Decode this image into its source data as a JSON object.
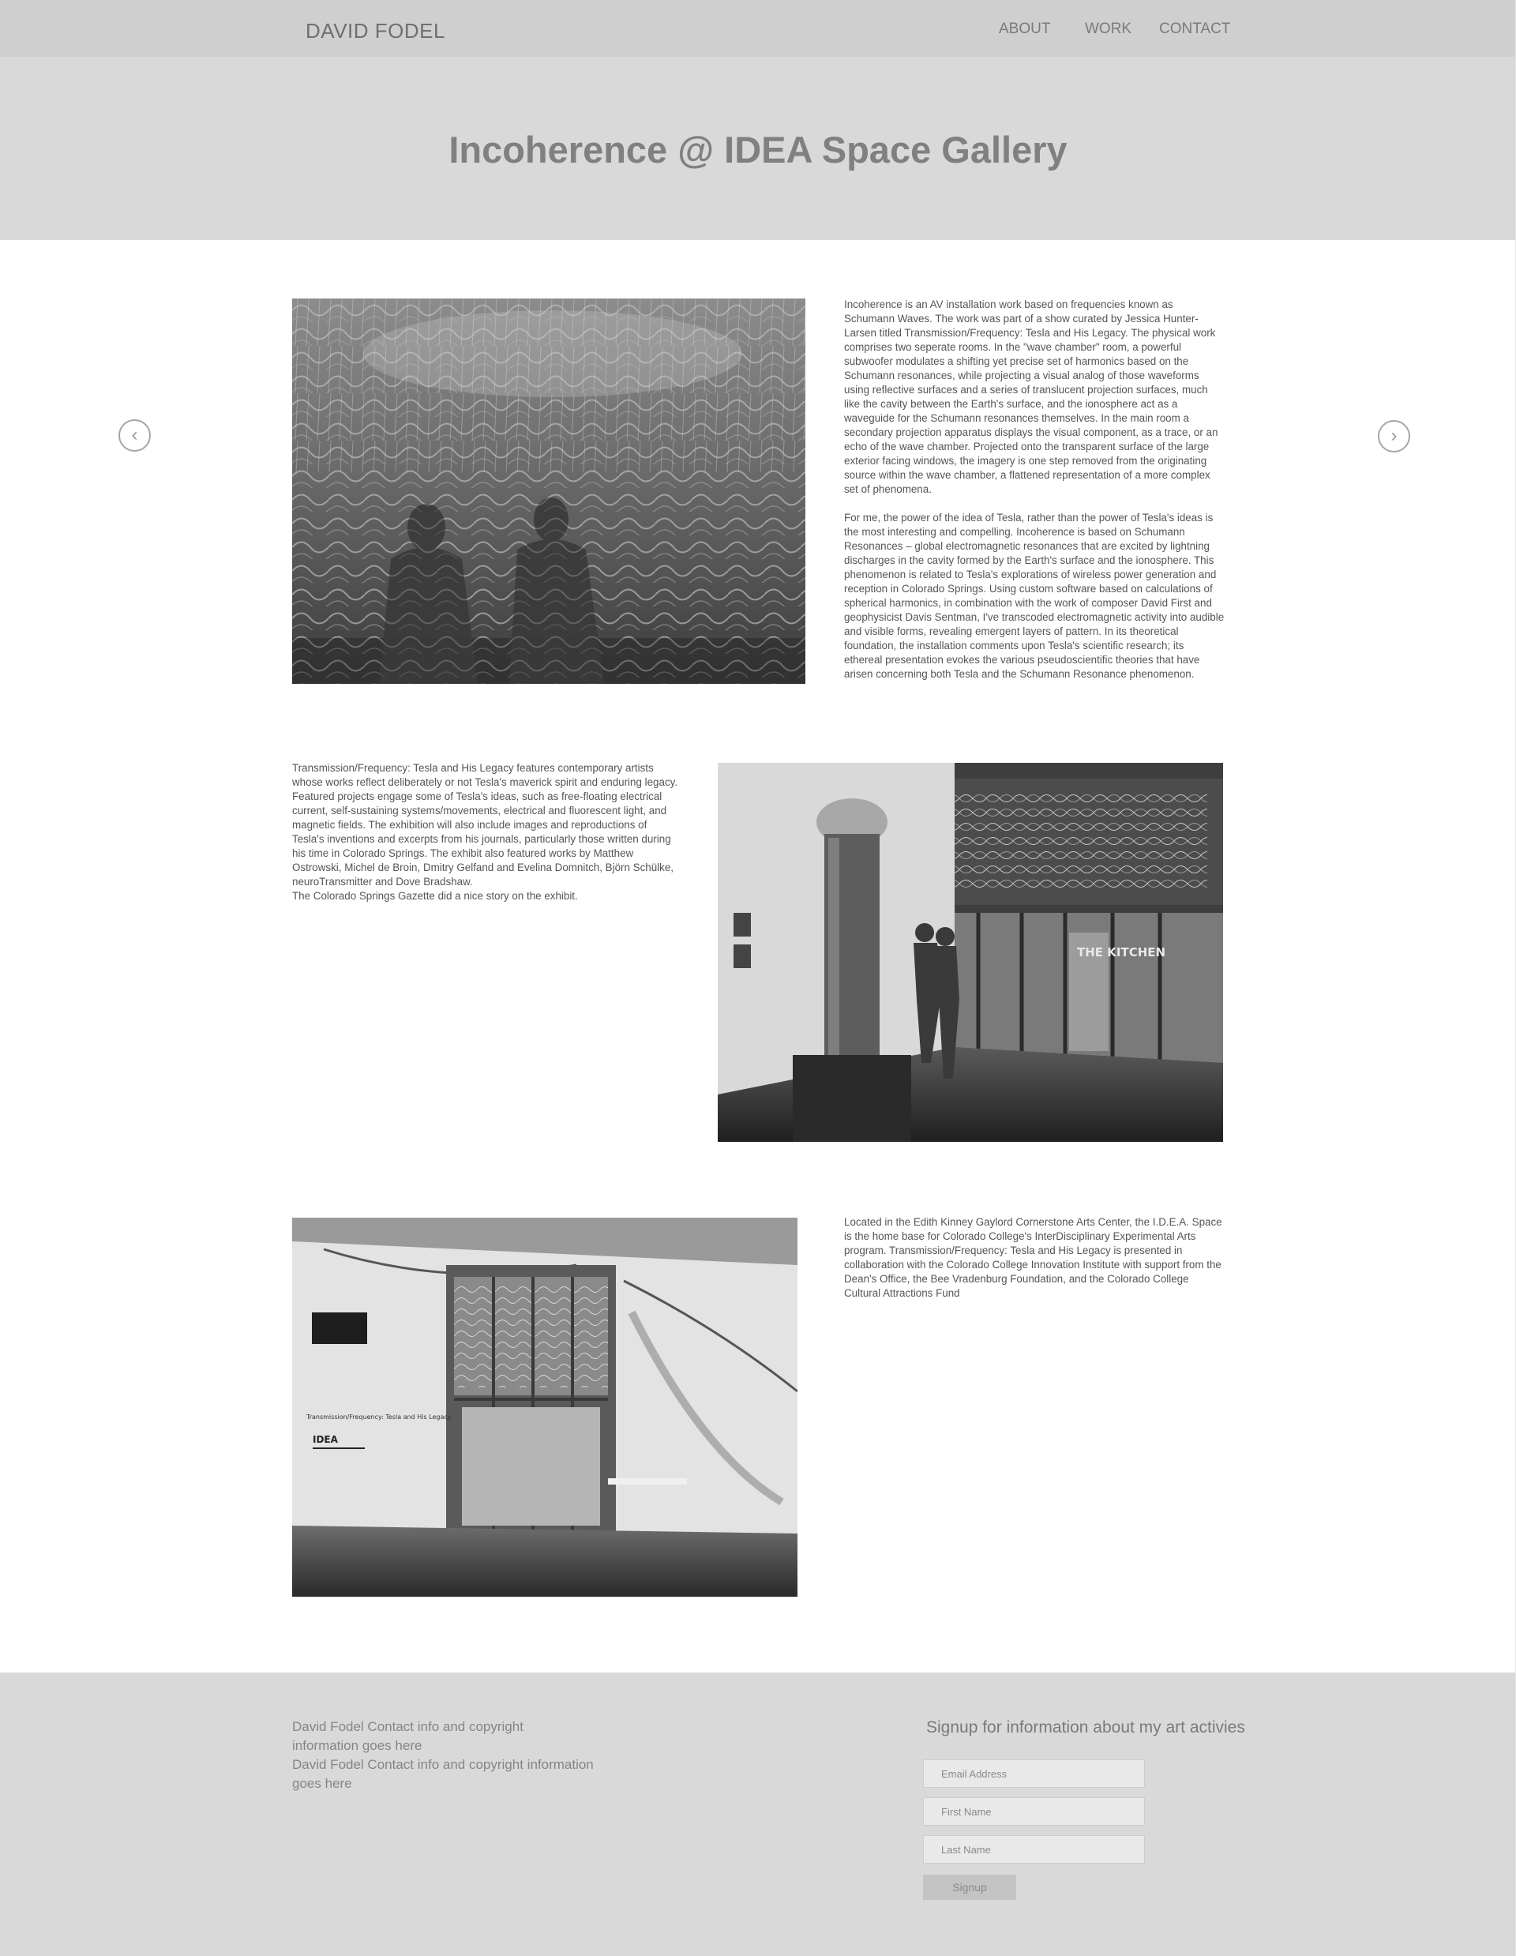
{
  "header": {
    "brand": "DAVID FODEL",
    "nav": {
      "about": "ABOUT",
      "work": "WORK",
      "contact": "CONTACT"
    }
  },
  "hero": {
    "title": "Incoherence @ IDEA Space Gallery"
  },
  "carousel": {
    "prev_glyph": "‹",
    "next_glyph": "›"
  },
  "section1": {
    "paragraphs": [
      "Incoherence is an AV installation work based on frequencies known as Schumann Waves. The work was part of a show curated by Jessica Hunter-Larsen titled Transmission/Frequency: Tesla and His Legacy. The physical work comprises two seperate rooms. In the \"wave chamber\" room, a powerful subwoofer modulates a shifting yet precise set of harmonics based on the Schumann resonances, while projecting a visual analog of those waveforms using reflective surfaces and a series of translucent projection surfaces, much like the cavity between the Earth's surface, and the ionosphere act as a waveguide for the Schumann resonances themselves. In the main room a secondary projection apparatus displays the visual component, as a trace, or an echo of the wave chamber. Projected onto the transparent surface of the large exterior facing windows, the imagery is one step removed from the originating source within the wave chamber, a flattened representation of a more complex set of phenomena.",
      "For me, the power of the idea of Tesla, rather than the power of Tesla's ideas is the most interesting and compelling. Incoherence is based on Schumann Resonances – global electromagnetic resonances that are excited by lightning discharges in the cavity formed by the Earth's surface and the ionosphere. This phenomenon is related to Tesla's explorations of wireless power generation and reception in Colorado Springs. Using custom software based on calculations of spherical harmonics, in combination with the work of composer David First and geophysicist Davis Sentman, I've transcoded electromagnetic activity into audible and visible forms, revealing emergent layers of pattern. In its theoretical foundation, the installation comments upon Tesla's scientific research; its ethereal presentation evokes the various pseudoscientific theories that have arisen concerning both Tesla and the Schumann Resonance phenomenon."
    ]
  },
  "section2": {
    "text": "Transmission/Frequency: Tesla and His Legacy features contemporary artists whose works reflect deliberately or not Tesla's maverick spirit and enduring legacy. Featured projects engage some of Tesla's ideas, such as free-floating electrical current, self-sustaining systems/movements, electrical and fluorescent light, and magnetic fields. The exhibition will also include images and reproductions of Tesla's inventions and excerpts from his journals, particularly those written during his time in Colorado Springs. The exhibit also featured works by Matthew Ostrowski, Michel de Broin, Dmitry Gelfand and Evelina Domnitch, Björn Schülke, neuroTransmitter and Dove Bradshaw.",
    "gazette": "The Colorado Springs Gazette did a nice story on the exhibit.",
    "photo_sign": "THE KITCHEN"
  },
  "section3": {
    "text": "Located in the Edith Kinney Gaylord Cornerstone Arts Center, the I.D.E.A. Space is the home base for Colorado College's InterDisciplinary Experimental Arts program. Transmission/Frequency: Tesla and His Legacy is presented in collaboration with the Colorado College Innovation Institute with support from the Dean's Office, the Bee Vradenburg Foundation, and the Colorado College Cultural Attractions Fund",
    "photo_sign_title": "Transmission/Frequency: Tesla and His Legacy",
    "photo_sign_logo": "IDEA"
  },
  "footer": {
    "info_lines": [
      "David Fodel Contact info and copyright information goes here",
      "David Fodel Contact info and copyright information goes here"
    ],
    "signup_title": "Signup for information about my art activies",
    "email_placeholder": "Email Address",
    "first_placeholder": "First Name",
    "last_placeholder": "Last Name",
    "signup_button": "Signup"
  }
}
